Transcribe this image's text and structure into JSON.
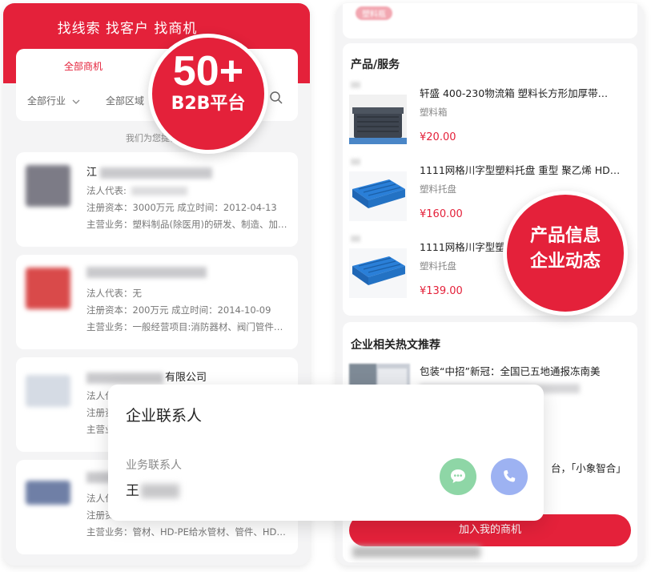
{
  "left": {
    "header_title": "找线索 找客户 找商机",
    "tab_active": "全部商机",
    "filter_industry": "全部行业",
    "filter_region": "全部区域",
    "provide_text": "我们为您提供了",
    "companies": [
      {
        "name_prefix": "江",
        "line1": "法人代表:",
        "line2": "注册资本：3000万元  成立时间：2012-04-13",
        "line3": "主营业务：塑料制品(除医用)的研发、制造、加…",
        "logo_color": "#7c7b86"
      },
      {
        "name_prefix": "",
        "line1": "法人代表：无",
        "line2": "注册资本：200万元  成立时间：2014-10-09",
        "line3": "主营业务：一般经营项目:消防器材、阀门管件…",
        "logo_color": "#d94a4a"
      },
      {
        "name_prefix": "有限公司",
        "line1": "法人代表",
        "line2": "注册资本",
        "line3": "主营业务",
        "logo_color": "#d5dbe4"
      },
      {
        "name_prefix": "",
        "line1": "法人代表",
        "line2": "注册资本",
        "line3": "主营业务：管材、HD-PE给水管材、管件、HD…",
        "logo_color": "#6f7fa6"
      }
    ]
  },
  "badge_left": {
    "big": "50+",
    "small": "B2B平台"
  },
  "right": {
    "tag": "塑料瓶",
    "products_title": "产品/服务",
    "products": [
      {
        "name": "轩盛 400-230物流箱 塑料长方形加厚带…",
        "category": "塑料箱",
        "price": "¥20.00"
      },
      {
        "name": "1111网格川字型塑料托盘 重型 聚乙烯 HD…",
        "category": "塑料托盘",
        "price": "¥160.00"
      },
      {
        "name": "1111网格川字型塑料",
        "category": "塑料托盘",
        "price": "¥139.00"
      }
    ],
    "hot_title": "企业相关热文推荐",
    "hot_article": "包装“中招”新冠：全国已五地通报冻南美",
    "hot_article2": "台，「小象智合」",
    "join_button": "加入我的商机"
  },
  "badge_right": {
    "line1": "产品信息",
    "line2": "企业动态"
  },
  "contact": {
    "title": "企业联系人",
    "label": "业务联系人",
    "name_prefix": "王"
  },
  "colors": {
    "brand_red": "#e4213a",
    "chat_green": "#8ed6a6",
    "phone_blue": "#9db2f2"
  }
}
